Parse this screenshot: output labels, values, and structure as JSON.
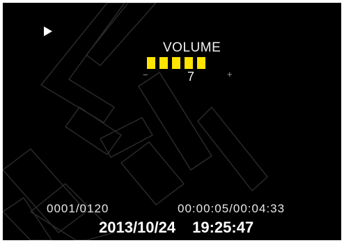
{
  "osd": {
    "volume": {
      "title": "VOLUME",
      "minus_label": "−",
      "plus_label": "+",
      "level_text": "7",
      "filled_bars": 5,
      "bar_color": "#ffe400"
    },
    "playback": {
      "state_icon": "play-icon",
      "file_counter": "0001/0120",
      "elapsed_total": "00:00:05/00:04:33",
      "date": "2013/10/24",
      "time": "19:25:47"
    },
    "colors": {
      "screen_background": "#000000",
      "frame_background": "#ffffff",
      "text": "#e8e8e8"
    }
  }
}
